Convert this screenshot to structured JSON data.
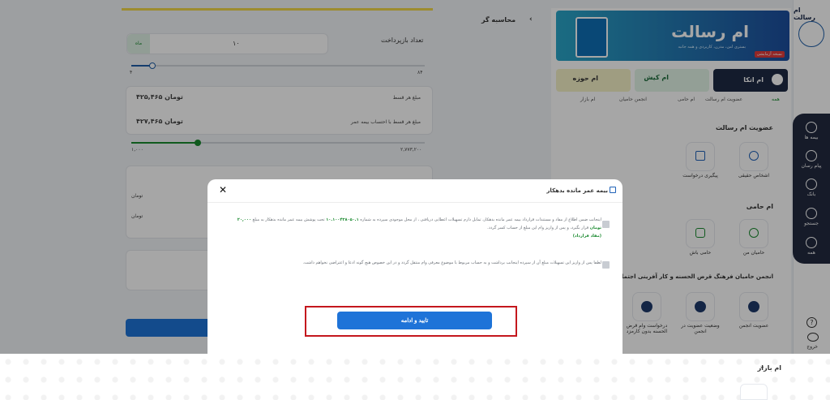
{
  "app": {
    "brand": "ام رسالت"
  },
  "rail": {
    "items": [
      {
        "label": "بیمه ها",
        "icon": "box-icon"
      },
      {
        "label": "پیام رسان",
        "icon": "chat-icon"
      },
      {
        "label": "بانک",
        "icon": "bank-icon"
      },
      {
        "label": "جستجو",
        "icon": "search-icon"
      },
      {
        "label": "همه",
        "icon": "grid-icon"
      }
    ],
    "help_icon": "help-icon",
    "logout_label": "خروج",
    "logout_icon": "logout-icon"
  },
  "banner": {
    "title": "ام رسالت",
    "subtitle": "بستری امن، مدرن، کاربردی و همه جانبه",
    "tag": "نسخه آزمایشی"
  },
  "services": [
    {
      "label": "ام اتکا"
    },
    {
      "label": "ام کیش"
    },
    {
      "label": "ام حوزه"
    }
  ],
  "chips": [
    "همه",
    "عضویت ام رسالت",
    "ام حامی",
    "انجمن حامیان",
    "ام بازار"
  ],
  "sections": {
    "membership": {
      "title": "عضویت ام رسالت",
      "tiles": [
        {
          "label": "اشخاص حقیقی",
          "icon": "user-icon"
        },
        {
          "label": "پیگیری درخواست",
          "icon": "tracking-icon"
        }
      ]
    },
    "hami": {
      "title": "ام حامی",
      "tiles": [
        {
          "label": "حامیان من",
          "icon": "people-icon"
        },
        {
          "label": "حامی باش",
          "icon": "shield-icon"
        }
      ]
    },
    "association": {
      "title": "انجمن حامیان فرهنگ قرض الحسنه و کار آفرینی اجتماعی",
      "tiles": [
        {
          "label": "عضویت انجمن",
          "icon": "logo-icon"
        },
        {
          "label": "وضعیت عضویت در انجمن",
          "icon": "logo-icon"
        },
        {
          "label": "درخواست وام قرض الحسنه بدون کارمزد",
          "icon": "logo-icon"
        }
      ]
    },
    "bazaar": {
      "title": "ام بازار"
    }
  },
  "calculator": {
    "title": "محاسبه گر",
    "installments_label": "تعداد بازپرداخت",
    "installments_value": "۱۰",
    "installments_unit": "ماه",
    "slider_max": "۸۴",
    "slider_min": "۴",
    "installment_amount_label": "مبلغ هر قسط",
    "installment_amount": "۴۲۵,۴۶۵ تومان",
    "installment_with_insurance_label": "مبلغ هر قسط با احتساب بیمه عمر",
    "installment_with_insurance": "۴۲۷,۴۶۵ تومان",
    "range_left": "۱,۰۰۰",
    "range_right": "۲,۷۷۳,۲۰۰",
    "unit_toman": "تومان"
  },
  "modal": {
    "title": "بیمه عمر مانده بدهکار",
    "paragraph1_a": "اینجانب ضمن اطلاع از مفاد و مستندات قرارداد بیمه عمر مانده بدهکار، تمایل دارم تسهیلات اعطایی دریافتی ، از محل موجودی سپرده به شماره",
    "account_number": "۱۰.۱۰۰۴۳۸۰۵۰.۱",
    "paragraph1_b": "تحت پوشش بیمه عمر مانده بدهکار به مبلغ",
    "amount": "۲۰,۰۰۰ تومان",
    "paragraph1_c": "قرار بگیرد، و پس از واریز وام این مبلغ از حساب کسر گردد.",
    "contract_link": "(مفاد قرارداد)",
    "paragraph2": "لطفا پس از واریز این تسهیلات مبلغ آن از سپرده اینجانب برداشت و به حساب مربوط با موضوع معرفی وام منتقل گردد و در این خصوص هیچ گونه ادعا و اعتراضی نخواهم داشت.",
    "confirm_label": "تایید و ادامه"
  }
}
